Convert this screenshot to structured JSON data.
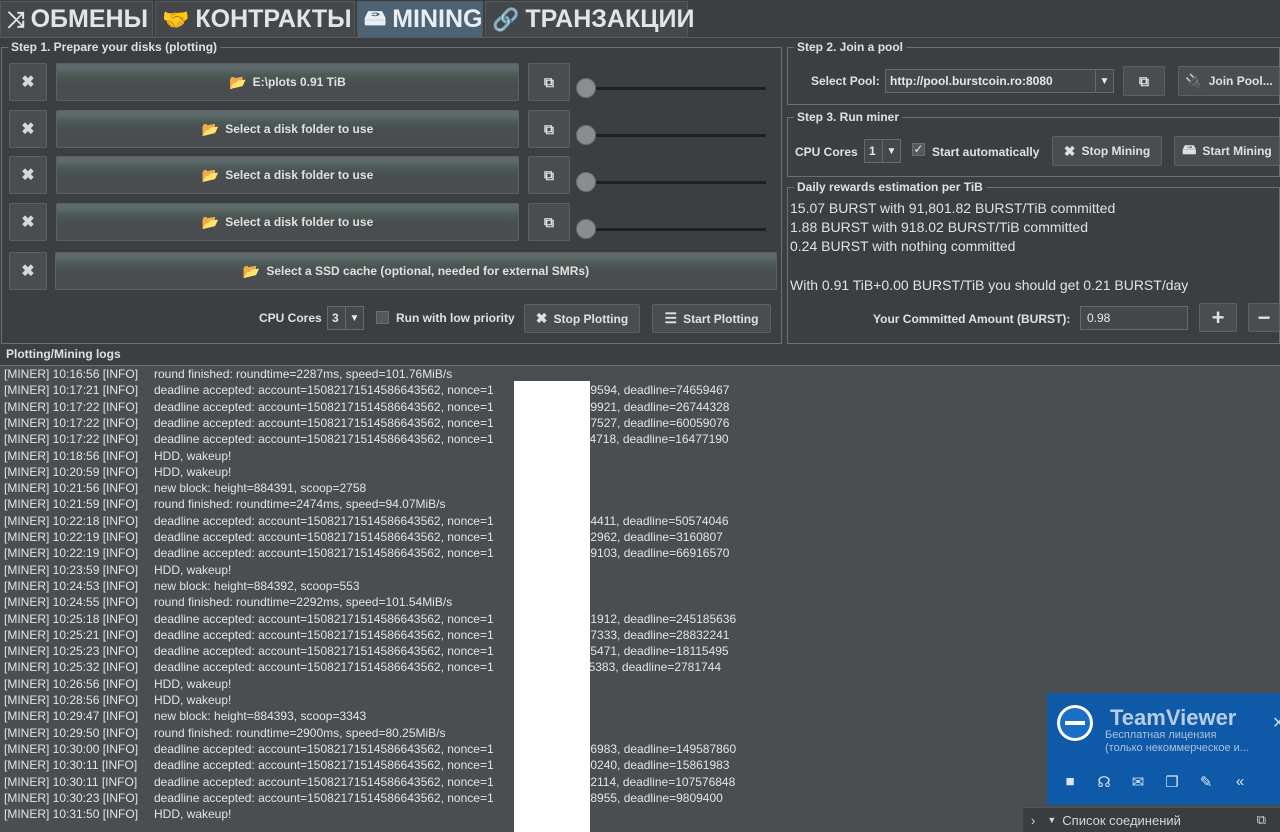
{
  "tabs": [
    {
      "icon": "⤨",
      "label": "ОБМЕНЫ"
    },
    {
      "icon": "🤝",
      "label": "КОНТРАКТЫ"
    },
    {
      "icon": "🖴",
      "label": "MINING"
    },
    {
      "icon": "🔗",
      "label": "ТРАНЗАКЦИИ"
    }
  ],
  "step1": {
    "legend": "Step 1. Prepare your disks (plotting)",
    "disks": [
      {
        "label": "E:\\plots 0.91 TiB"
      },
      {
        "label": "Select a disk folder to use"
      },
      {
        "label": "Select a disk folder to use"
      },
      {
        "label": "Select a disk folder to use"
      }
    ],
    "ssd_label": "Select a SSD cache (optional, needed for external SMRs)",
    "cpu_label": "CPU Cores",
    "cpu_value": "3",
    "low_priority_label": "Run with low priority",
    "stop_plotting": "Stop Plotting",
    "start_plotting": "Start Plotting"
  },
  "step2": {
    "legend": "Step 2. Join a pool",
    "select_pool_label": "Select Pool:",
    "pool_value": "http://pool.burstcoin.ro:8080",
    "join_label": "Join Pool..."
  },
  "step3": {
    "legend": "Step 3. Run miner",
    "cpu_label": "CPU Cores",
    "cpu_value": "1",
    "start_auto_label": "Start automatically",
    "start_auto_checked": "✓",
    "stop_mining": "Stop Mining",
    "start_mining": "Start Mining"
  },
  "rewards": {
    "legend": "Daily rewards estimation per TiB",
    "lines": [
      "15.07 BURST with 91,801.82 BURST/TiB committed",
      "1.88 BURST with 918.02 BURST/TiB committed",
      "0.24 BURST with nothing committed"
    ],
    "summary": "With 0.91 TiB+0.00 BURST/TiB you should get 0.21 BURST/day",
    "committed_label": "Your Committed Amount (BURST):",
    "committed_value": "0.98",
    "plus": "+",
    "minus": "−"
  },
  "logs": {
    "legend": "Plotting/Mining logs",
    "lines": [
      {
        "prefix": "[MINER] 10:16:56 [INFO]",
        "msg": "round finished: roundtime=2287ms, speed=101.76MiB/s"
      },
      {
        "prefix": "[MINER] 10:17:21 [INFO]",
        "msg": "deadline accepted: account=15082171514586643562, nonce=1                     07759594, deadline=74659467"
      },
      {
        "prefix": "[MINER] 10:17:22 [INFO]",
        "msg": "deadline accepted: account=15082171514586643562, nonce=1                     09849921, deadline=26744328"
      },
      {
        "prefix": "[MINER] 10:17:22 [INFO]",
        "msg": "deadline accepted: account=15082171514586643562, nonce=1                     08467527, deadline=60059076"
      },
      {
        "prefix": "[MINER] 10:17:22 [INFO]",
        "msg": "deadline accepted: account=15082171514586643562, nonce=1                     11244718, deadline=16477190"
      },
      {
        "prefix": "[MINER] 10:18:56 [INFO]",
        "msg": "HDD, wakeup!"
      },
      {
        "prefix": "[MINER] 10:20:59 [INFO]",
        "msg": "HDD, wakeup!"
      },
      {
        "prefix": "[MINER] 10:21:56 [INFO]",
        "msg": "new block: height=884391, scoop=2758"
      },
      {
        "prefix": "[MINER] 10:21:59 [INFO]",
        "msg": "round finished: roundtime=2474ms, speed=94.07MiB/s"
      },
      {
        "prefix": "[MINER] 10:22:18 [INFO]",
        "msg": "deadline accepted: account=15082171514586643562, nonce=1                     08704411, deadline=50574046"
      },
      {
        "prefix": "[MINER] 10:22:19 [INFO]",
        "msg": "deadline accepted: account=15082171514586643562, nonce=1                     09162962, deadline=3160807"
      },
      {
        "prefix": "[MINER] 10:22:19 [INFO]",
        "msg": "deadline accepted: account=15082171514586643562, nonce=1                     07689103, deadline=66916570"
      },
      {
        "prefix": "[MINER] 10:23:59 [INFO]",
        "msg": "HDD, wakeup!"
      },
      {
        "prefix": "[MINER] 10:24:53 [INFO]",
        "msg": "new block: height=884392, scoop=553"
      },
      {
        "prefix": "[MINER] 10:24:55 [INFO]",
        "msg": "round finished: roundtime=2292ms, speed=101.54MiB/s"
      },
      {
        "prefix": "[MINER] 10:25:18 [INFO]",
        "msg": "deadline accepted: account=15082171514586643562, nonce=1                     07691912, deadline=245185636"
      },
      {
        "prefix": "[MINER] 10:25:21 [INFO]",
        "msg": "deadline accepted: account=15082171514586643562, nonce=1                     08087333, deadline=28832241"
      },
      {
        "prefix": "[MINER] 10:25:23 [INFO]",
        "msg": "deadline accepted: account=15082171514586643562, nonce=1                     09295471, deadline=18115495"
      },
      {
        "prefix": "[MINER] 10:25:32 [INFO]",
        "msg": "deadline accepted: account=15082171514586643562, nonce=1                     11195383, deadline=2781744"
      },
      {
        "prefix": "[MINER] 10:26:56 [INFO]",
        "msg": "HDD, wakeup!"
      },
      {
        "prefix": "[MINER] 10:28:56 [INFO]",
        "msg": "HDD, wakeup!"
      },
      {
        "prefix": "[MINER] 10:29:47 [INFO]",
        "msg": "new block: height=884393, scoop=3343"
      },
      {
        "prefix": "[MINER] 10:29:50 [INFO]",
        "msg": "round finished: roundtime=2900ms, speed=80.25MiB/s"
      },
      {
        "prefix": "[MINER] 10:30:00 [INFO]",
        "msg": "deadline accepted: account=15082171514586643562, nonce=1                     07856983, deadline=149587860"
      },
      {
        "prefix": "[MINER] 10:30:11 [INFO]",
        "msg": "deadline accepted: account=15082171514586643562, nonce=1                     08960240, deadline=15861983"
      },
      {
        "prefix": "[MINER] 10:30:11 [INFO]",
        "msg": "deadline accepted: account=15082171514586643562, nonce=1                     08412114, deadline=107576848"
      },
      {
        "prefix": "[MINER] 10:30:23 [INFO]",
        "msg": "deadline accepted: account=15082171514586643562, nonce=1                     10388955, deadline=9809400"
      },
      {
        "prefix": "[MINER] 10:31:50 [INFO]",
        "msg": "HDD, wakeup!"
      }
    ]
  },
  "teamviewer": {
    "title": "TeamViewer",
    "license_line1": "Бесплатная лицензия",
    "license_line2": "(только некоммерческое и...",
    "footer": "Список соединений"
  },
  "colors": {
    "background": "#3c3f41",
    "active_tab": "#4d6272",
    "teamviewer_blue": "#0e5aa8"
  }
}
